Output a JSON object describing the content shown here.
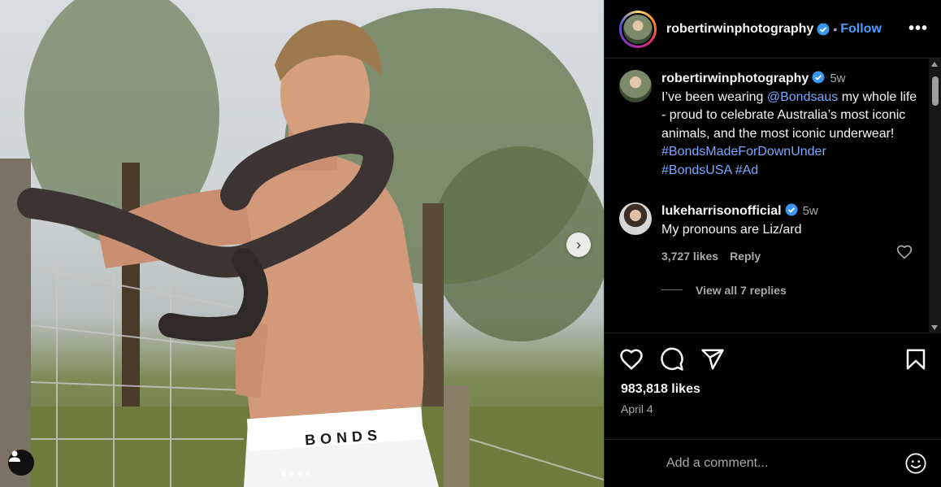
{
  "post": {
    "username": "robertirwinphotography",
    "follow_label": "Follow",
    "separator": "•",
    "more_label": "•••",
    "carousel": {
      "slide_count": 4,
      "active_index": 0,
      "next_label": "›"
    }
  },
  "photo": {
    "waistband_text": "BONDS"
  },
  "caption": {
    "username": "robertirwinphotography",
    "time": "5w",
    "text_before": "I’ve been wearing ",
    "mention": "@Bondsaus",
    "text_after": " my whole life - proud to celebrate Australia’s most iconic animals, and the most iconic underwear! ",
    "hashtags": [
      "#BondsMadeForDownUnder",
      "#BondsUSA",
      "#Ad"
    ]
  },
  "top_comment": {
    "username": "lukeharrisonofficial",
    "time": "5w",
    "text": "My pronouns are Liz/ard",
    "likes": "3,727 likes",
    "reply_label": "Reply",
    "view_replies": "View all 7 replies"
  },
  "stats": {
    "likes": "983,818 likes",
    "date": "April 4"
  },
  "comment_box": {
    "placeholder": "Add a comment..."
  },
  "colors": {
    "accent": "#4a9dff",
    "link": "#7aa7ff",
    "muted": "#a8a8a8",
    "background": "#000000"
  },
  "icons": [
    "verified-badge-icon",
    "more-icon",
    "heart-icon",
    "comment-icon",
    "share-icon",
    "bookmark-icon",
    "emoji-icon",
    "tag-user-icon",
    "chevron-right-icon"
  ]
}
